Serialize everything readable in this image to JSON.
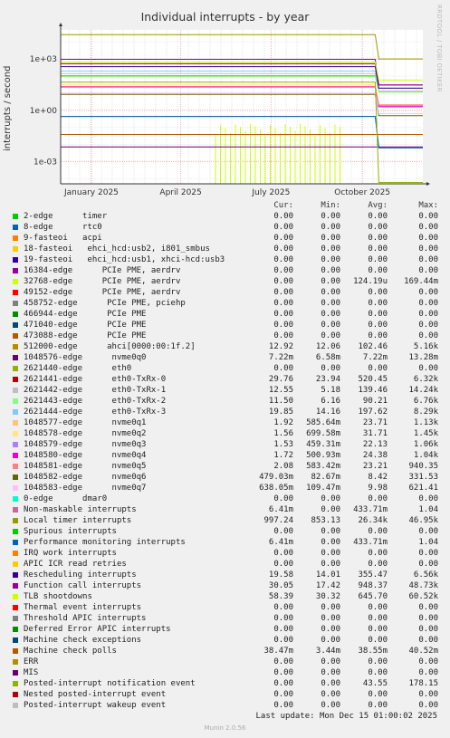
{
  "title": "Individual interrupts - by year",
  "ylabel": "interrupts / second",
  "watermark": "RRDTOOL / TOBI OETIKER",
  "headers": {
    "cur": "Cur:",
    "min": "Min:",
    "avg": "Avg:",
    "max": "Max:"
  },
  "footer": "Last update: Mon Dec 15 01:00:02 2025",
  "version": "Munin 2.0.56",
  "chart_data": {
    "type": "line",
    "title": "Individual interrupts - by year",
    "ylabel": "interrupts / second",
    "yscale": "log",
    "ylim": [
      5e-05,
      50000
    ],
    "yticks": [
      {
        "v": 0.001,
        "label": "1e-03"
      },
      {
        "v": 1,
        "label": "1e+00"
      },
      {
        "v": 1000,
        "label": "1e+03"
      }
    ],
    "x_range": [
      "2024-12-15",
      "2025-12-15"
    ],
    "x_ticks": [
      {
        "date": "2025-01-15",
        "label": "January 2025"
      },
      {
        "date": "2025-04-15",
        "label": "April 2025"
      },
      {
        "date": "2025-07-15",
        "label": "July 2025"
      },
      {
        "date": "2025-10-15",
        "label": "October 2025"
      }
    ],
    "grid": true,
    "series": [
      {
        "name": "2-edge      timer",
        "color": "#00cc00",
        "cur": "0.00",
        "min": "0.00",
        "avg": "0.00",
        "max": "0.00"
      },
      {
        "name": "8-edge      rtc0",
        "color": "#0066b3",
        "cur": "0.00",
        "min": "0.00",
        "avg": "0.00",
        "max": "0.00"
      },
      {
        "name": "9-fasteoi   acpi",
        "color": "#ff8000",
        "cur": "0.00",
        "min": "0.00",
        "avg": "0.00",
        "max": "0.00"
      },
      {
        "name": "18-fasteoi   ehci_hcd:usb2, i801_smbus",
        "color": "#ffcc00",
        "cur": "0.00",
        "min": "0.00",
        "avg": "0.00",
        "max": "0.00"
      },
      {
        "name": "19-fasteoi   ehci_hcd:usb1, xhci-hcd:usb3",
        "color": "#330099",
        "cur": "0.00",
        "min": "0.00",
        "avg": "0.00",
        "max": "0.00"
      },
      {
        "name": "16384-edge      PCIe PME, aerdrv",
        "color": "#990099",
        "cur": "0.00",
        "min": "0.00",
        "avg": "0.00",
        "max": "0.00"
      },
      {
        "name": "32768-edge      PCIe PME, aerdrv",
        "color": "#ccff00",
        "cur": "0.00",
        "min": "0.00",
        "avg": "124.19u",
        "max": "169.44m"
      },
      {
        "name": "49152-edge      PCIe PME, aerdrv",
        "color": "#ff0000",
        "cur": "0.00",
        "min": "0.00",
        "avg": "0.00",
        "max": "0.00"
      },
      {
        "name": "458752-edge      PCIe PME, pciehp",
        "color": "#808080",
        "cur": "0.00",
        "min": "0.00",
        "avg": "0.00",
        "max": "0.00"
      },
      {
        "name": "466944-edge      PCIe PME",
        "color": "#008f00",
        "cur": "0.00",
        "min": "0.00",
        "avg": "0.00",
        "max": "0.00"
      },
      {
        "name": "471040-edge      PCIe PME",
        "color": "#00487d",
        "cur": "0.00",
        "min": "0.00",
        "avg": "0.00",
        "max": "0.00"
      },
      {
        "name": "473088-edge      PCIe PME",
        "color": "#b35a00",
        "cur": "0.00",
        "min": "0.00",
        "avg": "0.00",
        "max": "0.00"
      },
      {
        "name": "512000-edge      ahci[0000:00:1f.2]",
        "color": "#b38f00",
        "cur": "12.92",
        "min": "12.06",
        "avg": "102.46",
        "max": "5.16k"
      },
      {
        "name": "1048576-edge      nvme0q0",
        "color": "#6b006b",
        "cur": "7.22m",
        "min": "6.58m",
        "avg": "7.22m",
        "max": "13.28m"
      },
      {
        "name": "2621440-edge      eth0",
        "color": "#8fb300",
        "cur": "0.00",
        "min": "0.00",
        "avg": "0.00",
        "max": "0.00"
      },
      {
        "name": "2621441-edge      eth0-TxRx-0",
        "color": "#b30000",
        "cur": "29.76",
        "min": "23.94",
        "avg": "520.45",
        "max": "6.32k"
      },
      {
        "name": "2621442-edge      eth0-TxRx-1",
        "color": "#bebebe",
        "cur": "12.55",
        "min": "5.18",
        "avg": "139.46",
        "max": "14.24k"
      },
      {
        "name": "2621443-edge      eth0-TxRx-2",
        "color": "#80ff80",
        "cur": "11.50",
        "min": "6.16",
        "avg": "90.21",
        "max": "6.76k"
      },
      {
        "name": "2621444-edge      eth0-TxRx-3",
        "color": "#80c9ff",
        "cur": "19.85",
        "min": "14.16",
        "avg": "197.62",
        "max": "8.29k"
      },
      {
        "name": "1048577-edge      nvme0q1",
        "color": "#ffc080",
        "cur": "1.92",
        "min": "585.64m",
        "avg": "23.71",
        "max": "1.13k"
      },
      {
        "name": "1048578-edge      nvme0q2",
        "color": "#ffe680",
        "cur": "1.56",
        "min": "699.58m",
        "avg": "31.71",
        "max": "1.45k"
      },
      {
        "name": "1048579-edge      nvme0q3",
        "color": "#aa80ff",
        "cur": "1.53",
        "min": "459.31m",
        "avg": "22.13",
        "max": "1.06k"
      },
      {
        "name": "1048580-edge      nvme0q4",
        "color": "#ee00cc",
        "cur": "1.72",
        "min": "500.93m",
        "avg": "24.38",
        "max": "1.04k"
      },
      {
        "name": "1048581-edge      nvme0q5",
        "color": "#ff8080",
        "cur": "2.08",
        "min": "583.42m",
        "avg": "23.21",
        "max": "940.35"
      },
      {
        "name": "1048582-edge      nvme0q6",
        "color": "#666600",
        "cur": "479.03m",
        "min": "82.67m",
        "avg": "8.42",
        "max": "331.53"
      },
      {
        "name": "1048583-edge      nvme0q7",
        "color": "#ffbfff",
        "cur": "638.05m",
        "min": "109.47m",
        "avg": "9.98",
        "max": "621.41"
      },
      {
        "name": "0-edge      dmar0",
        "color": "#00ffcc",
        "cur": "0.00",
        "min": "0.00",
        "avg": "0.00",
        "max": "0.00"
      },
      {
        "name": "Non-maskable interrupts",
        "color": "#cc6699",
        "cur": "6.41m",
        "min": "0.00",
        "avg": "433.71m",
        "max": "1.04"
      },
      {
        "name": "Local timer interrupts",
        "color": "#999900",
        "cur": "997.24",
        "min": "853.13",
        "avg": "26.34k",
        "max": "46.95k"
      },
      {
        "name": "Spurious interrupts",
        "color": "#00cc00",
        "cur": "0.00",
        "min": "0.00",
        "avg": "0.00",
        "max": "0.00"
      },
      {
        "name": "Performance monitoring interrupts",
        "color": "#0066b3",
        "cur": "6.41m",
        "min": "0.00",
        "avg": "433.71m",
        "max": "1.04"
      },
      {
        "name": "IRQ work interrupts",
        "color": "#ff8000",
        "cur": "0.00",
        "min": "0.00",
        "avg": "0.00",
        "max": "0.00"
      },
      {
        "name": "APIC ICR read retries",
        "color": "#ffcc00",
        "cur": "0.00",
        "min": "0.00",
        "avg": "0.00",
        "max": "0.00"
      },
      {
        "name": "Rescheduling interrupts",
        "color": "#330099",
        "cur": "19.58",
        "min": "14.01",
        "avg": "355.47",
        "max": "6.56k"
      },
      {
        "name": "Function call interrupts",
        "color": "#990099",
        "cur": "30.05",
        "min": "17.42",
        "avg": "948.37",
        "max": "48.73k"
      },
      {
        "name": "TLB shootdowns",
        "color": "#ccff00",
        "cur": "58.39",
        "min": "30.32",
        "avg": "645.70",
        "max": "60.52k"
      },
      {
        "name": "Thermal event interrupts",
        "color": "#ff0000",
        "cur": "0.00",
        "min": "0.00",
        "avg": "0.00",
        "max": "0.00"
      },
      {
        "name": "Threshold APIC interrupts",
        "color": "#808080",
        "cur": "0.00",
        "min": "0.00",
        "avg": "0.00",
        "max": "0.00"
      },
      {
        "name": "Deferred Error APIC interrupts",
        "color": "#008f00",
        "cur": "0.00",
        "min": "0.00",
        "avg": "0.00",
        "max": "0.00"
      },
      {
        "name": "Machine check exceptions",
        "color": "#00487d",
        "cur": "0.00",
        "min": "0.00",
        "avg": "0.00",
        "max": "0.00"
      },
      {
        "name": "Machine check polls",
        "color": "#b35a00",
        "cur": "38.47m",
        "min": "3.44m",
        "avg": "38.55m",
        "max": "40.52m"
      },
      {
        "name": "ERR",
        "color": "#b38f00",
        "cur": "0.00",
        "min": "0.00",
        "avg": "0.00",
        "max": "0.00"
      },
      {
        "name": "MIS",
        "color": "#6b006b",
        "cur": "0.00",
        "min": "0.00",
        "avg": "0.00",
        "max": "0.00"
      },
      {
        "name": "Posted-interrupt notification event",
        "color": "#8fb300",
        "cur": "0.00",
        "min": "0.00",
        "avg": "43.55",
        "max": "178.15"
      },
      {
        "name": "Nested posted-interrupt event",
        "color": "#b30000",
        "cur": "0.00",
        "min": "0.00",
        "avg": "0.00",
        "max": "0.00"
      },
      {
        "name": "Posted-interrupt wakeup event",
        "color": "#bebebe",
        "cur": "0.00",
        "min": "0.00",
        "avg": "0.00",
        "max": "0.00"
      }
    ]
  }
}
